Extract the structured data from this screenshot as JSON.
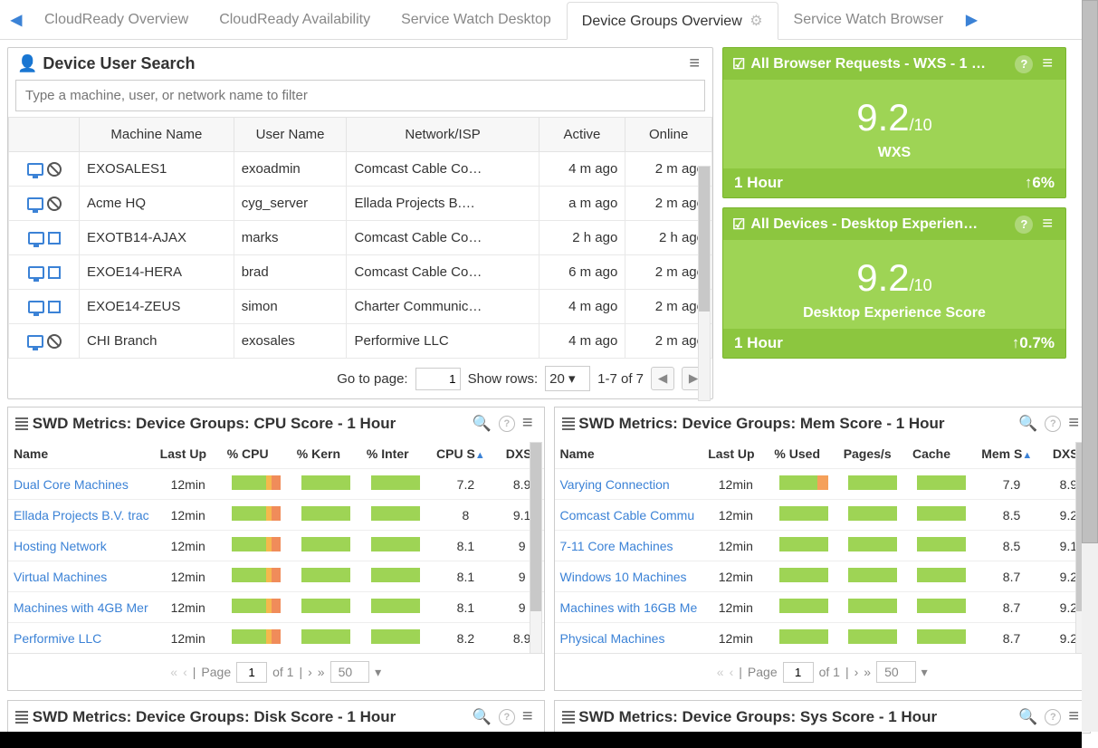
{
  "tabs": {
    "items": [
      "CloudReady Overview",
      "CloudReady Availability",
      "Service Watch Desktop",
      "Device Groups Overview",
      "Service Watch Browser"
    ],
    "active": 3
  },
  "search": {
    "title": "Device User Search",
    "placeholder": "Type a machine, user, or network name to filter",
    "columns": [
      "Machine Name",
      "User Name",
      "Network/ISP",
      "Active",
      "Online"
    ],
    "rows": [
      {
        "i": "ban",
        "m": "EXOSALES1",
        "u": "exoadmin",
        "n": "Comcast Cable Co…",
        "a": "4 m ago",
        "o": "2 m ago"
      },
      {
        "i": "ban",
        "m": "Acme HQ",
        "u": "cyg_server",
        "n": "Ellada Projects B.…",
        "a": "a m ago",
        "o": "2 m ago"
      },
      {
        "i": "sq",
        "m": "EXOTB14-AJAX",
        "u": "marks",
        "n": "Comcast Cable Co…",
        "a": "2 h ago",
        "o": "2 h ago"
      },
      {
        "i": "sq",
        "m": "EXOE14-HERA",
        "u": "brad",
        "n": "Comcast Cable Co…",
        "a": "6 m ago",
        "o": "2 m ago"
      },
      {
        "i": "sq",
        "m": "EXOE14-ZEUS",
        "u": "simon",
        "n": "Charter Communic…",
        "a": "4 m ago",
        "o": "2 m ago"
      },
      {
        "i": "ban",
        "m": "CHI Branch",
        "u": "exosales",
        "n": "Performive LLC",
        "a": "4 m ago",
        "o": "2 m ago"
      }
    ],
    "pager": {
      "goto": "Go to page:",
      "page": "1",
      "show": "Show rows:",
      "rows": "20",
      "range": "1-7 of 7"
    }
  },
  "cards": [
    {
      "title": "All Browser Requests - WXS - 1 …",
      "score": "9.2",
      "max": "/10",
      "label": "WXS",
      "period": "1 Hour",
      "delta": "↑6%"
    },
    {
      "title": "All Devices - Desktop Experien…",
      "score": "9.2",
      "max": "/10",
      "label": "Desktop Experience Score",
      "period": "1 Hour",
      "delta": "↑0.7%"
    }
  ],
  "cpu": {
    "title": "SWD Metrics: Device Groups: CPU Score - 1 Hour",
    "cols": [
      "Name",
      "Last Up",
      "% CPU",
      "% Kern",
      "% Inter",
      "CPU S",
      "DXS"
    ],
    "rows": [
      {
        "n": "Dual Core Machines",
        "t": "12min",
        "s": "7.2",
        "d": "8.9"
      },
      {
        "n": "Ellada Projects B.V. trac",
        "t": "12min",
        "s": "8",
        "d": "9.1"
      },
      {
        "n": "Hosting Network",
        "t": "12min",
        "s": "8.1",
        "d": "9"
      },
      {
        "n": "Virtual Machines",
        "t": "12min",
        "s": "8.1",
        "d": "9"
      },
      {
        "n": "Machines with 4GB Mer",
        "t": "12min",
        "s": "8.1",
        "d": "9"
      },
      {
        "n": "Performive LLC",
        "t": "12min",
        "s": "8.2",
        "d": "8.9"
      }
    ],
    "pager": {
      "page": "1",
      "of": "of 1",
      "rows": "50"
    }
  },
  "mem": {
    "title": "SWD Metrics: Device Groups: Mem Score - 1 Hour",
    "cols": [
      "Name",
      "Last Up",
      "% Used",
      "Pages/s",
      "Cache",
      "Mem S",
      "DXS"
    ],
    "rows": [
      {
        "n": "Varying Connection",
        "t": "12min",
        "s": "7.9",
        "d": "8.9"
      },
      {
        "n": "Comcast Cable Commu",
        "t": "12min",
        "s": "8.5",
        "d": "9.2"
      },
      {
        "n": "7-11 Core Machines",
        "t": "12min",
        "s": "8.5",
        "d": "9.1"
      },
      {
        "n": "Windows 10 Machines",
        "t": "12min",
        "s": "8.7",
        "d": "9.2"
      },
      {
        "n": "Machines with 16GB Me",
        "t": "12min",
        "s": "8.7",
        "d": "9.2"
      },
      {
        "n": "Physical Machines",
        "t": "12min",
        "s": "8.7",
        "d": "9.2"
      }
    ],
    "pager": {
      "page": "1",
      "of": "of 1",
      "rows": "50"
    }
  },
  "disk": {
    "title": "SWD Metrics: Device Groups: Disk Score - 1 Hour"
  },
  "sys": {
    "title": "SWD Metrics: Device Groups: Sys Score - 1 Hour"
  },
  "lbl": {
    "page": "Page"
  }
}
